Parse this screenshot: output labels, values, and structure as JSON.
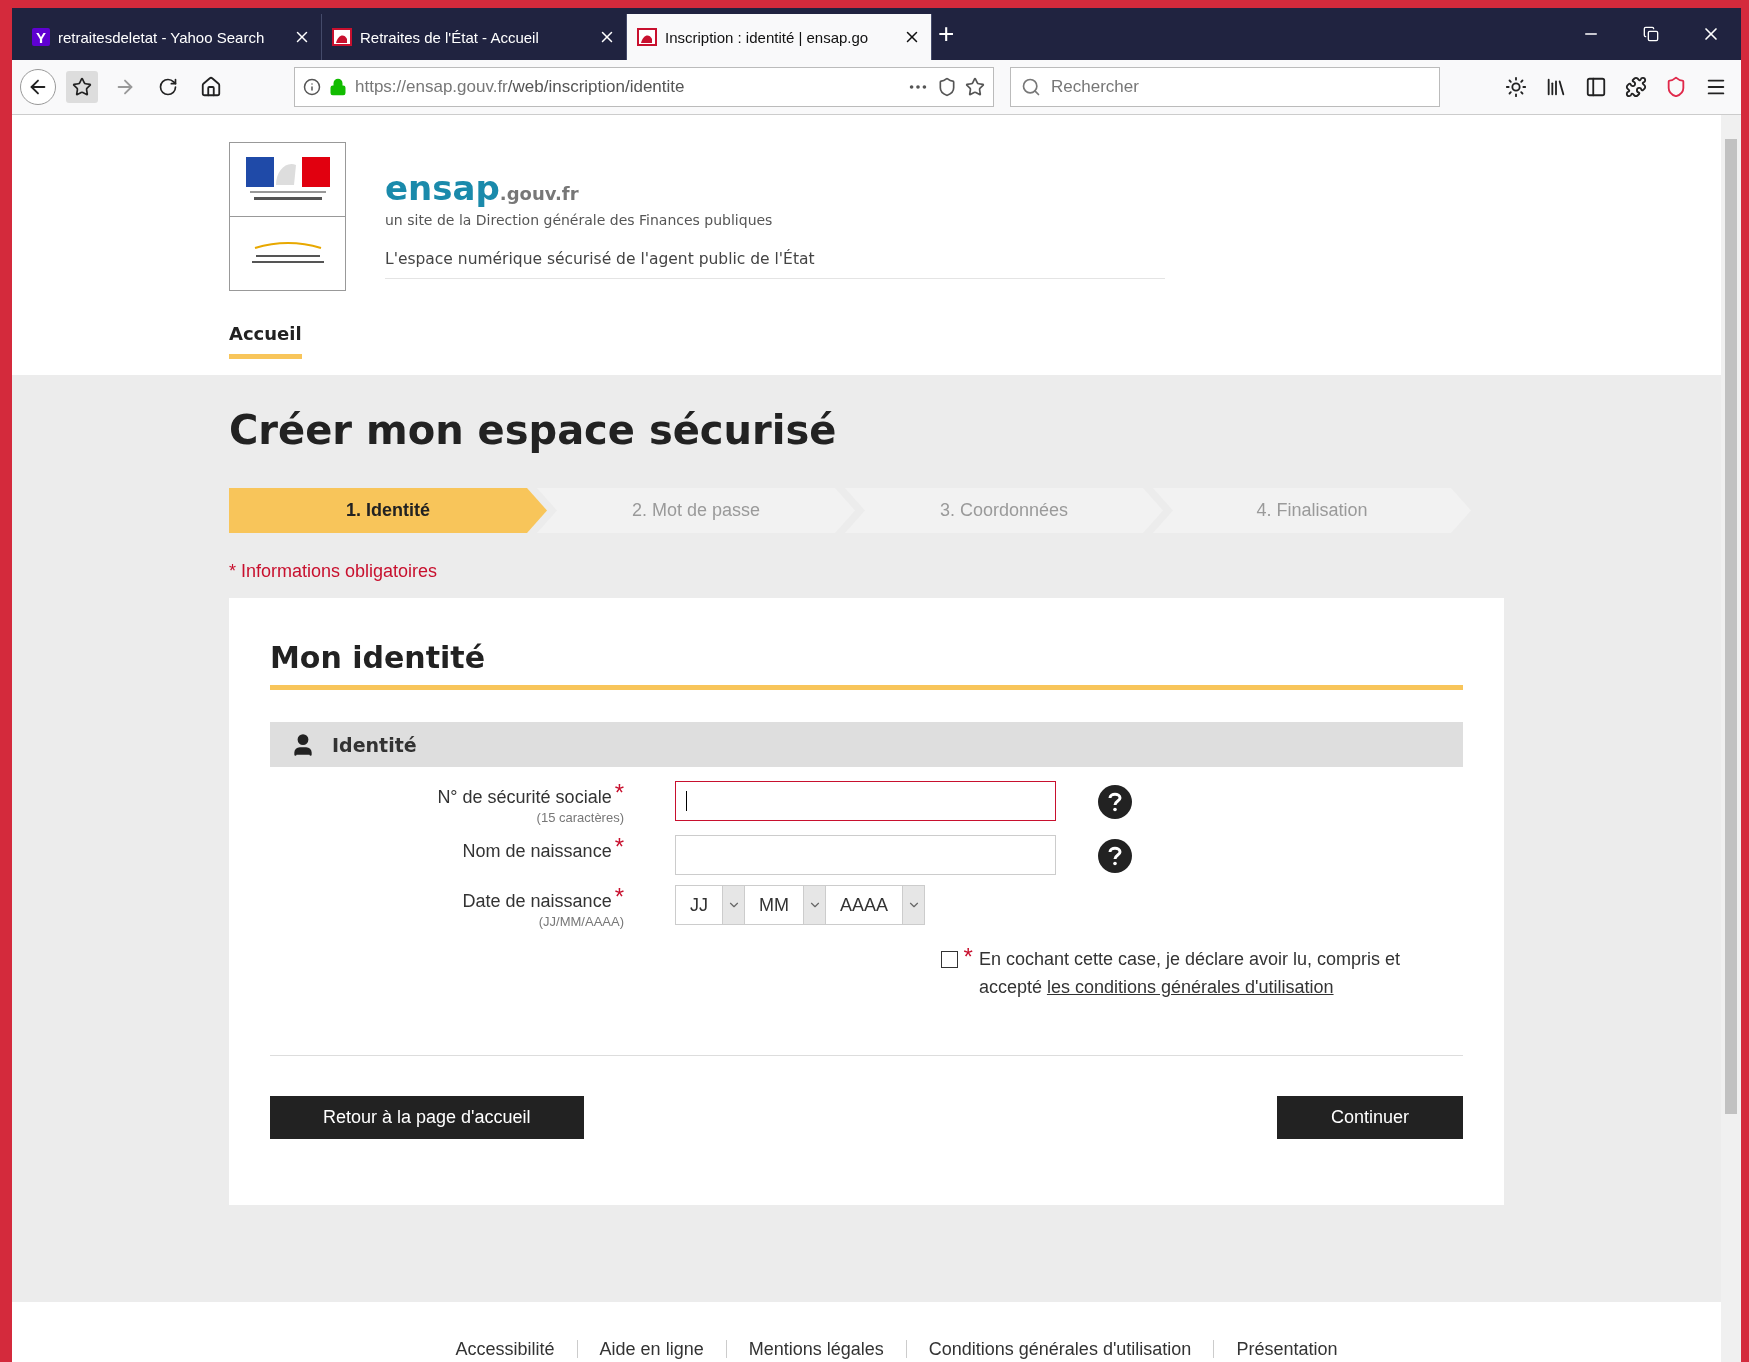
{
  "browser": {
    "tabs": [
      {
        "favicon_text": "Y",
        "title": "retraitesdeletat - Yahoo Search",
        "selected": false
      },
      {
        "title": "Retraites de l'État - Accueil",
        "selected": false
      },
      {
        "title": "Inscription : identité | ensap.go",
        "selected": true
      }
    ],
    "new_tab": "+",
    "url_host": "https://ensap.gouv.fr",
    "url_path": "/web/inscription/identite",
    "search": {
      "placeholder": "Rechercher"
    }
  },
  "header": {
    "brand": "ensap",
    "domain": ".gouv.fr",
    "subtitle": "un site de la Direction générale des Finances publiques",
    "tagline": "L'espace numérique sécurisé de l'agent public de l'État",
    "nav": [
      {
        "label": "Accueil",
        "selected": true
      }
    ]
  },
  "page_title": "Créer mon espace sécurisé",
  "steps": [
    {
      "label": "1. Identité",
      "selected": true
    },
    {
      "label": "2. Mot de passe",
      "selected": false
    },
    {
      "label": "3. Coordonnées",
      "selected": false
    },
    {
      "label": "4. Finalisation",
      "selected": false
    }
  ],
  "required_note": "* Informations obligatoires",
  "form": {
    "title": "Mon identité",
    "section": "Identité",
    "fields": [
      {
        "kind": "text",
        "label": "N° de sécurité sociale",
        "required_mark": "*",
        "hint": "(15 caractères)",
        "focused": true,
        "help": true
      },
      {
        "kind": "text",
        "label": "Nom de naissance",
        "required_mark": "*",
        "focused": false,
        "help": true
      },
      {
        "kind": "date",
        "label": "Date de naissance",
        "required_mark": "*",
        "hint": "(JJ/MM/AAAA)",
        "selects": [
          "JJ",
          "MM",
          "AAAA"
        ]
      }
    ],
    "consent": {
      "checked": false,
      "required_mark": "*",
      "text": "En cochant cette case, je déclare avoir lu, compris et accepté ",
      "link": "les conditions générales d'utilisation"
    },
    "buttons": [
      {
        "label": "Retour à la page d'accueil"
      },
      {
        "label": "Continuer"
      }
    ]
  },
  "footer": {
    "links": [
      "Accessibilité",
      "Aide en ligne",
      "Mentions légales",
      "Conditions générales d'utilisation",
      "Présentation"
    ]
  }
}
